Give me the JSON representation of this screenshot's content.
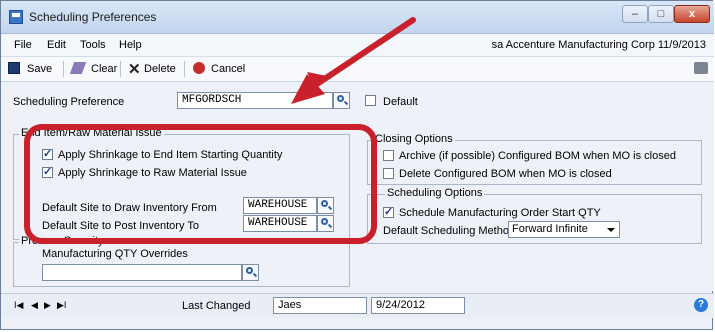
{
  "window": {
    "title": "Scheduling Preferences",
    "minimize": "–",
    "maximize": "□",
    "close": "x"
  },
  "menu": {
    "items": [
      "File",
      "Edit",
      "Tools",
      "Help"
    ],
    "company": "sa  Accenture Manufacturing Corp  11/9/2013"
  },
  "toolbar": {
    "save": "Save",
    "clear": "Clear",
    "delete": "Delete",
    "cancel": "Cancel"
  },
  "preference": {
    "label": "Scheduling Preference",
    "value": "MFGORDSCH",
    "default_label": "Default"
  },
  "end_item": {
    "title": "End Item/Raw Material Issue",
    "shrink_end": "Apply Shrinkage to End Item Starting Quantity",
    "shrink_raw": "Apply Shrinkage to Raw Material Issue",
    "draw_label": "Default Site to Draw Inventory From",
    "draw_value": "WAREHOUSE",
    "post_label": "Default Site to Post Inventory To",
    "post_value": "WAREHOUSE"
  },
  "closing": {
    "title": "Closing Options",
    "archive": "Archive (if possible) Configured BOM when MO is closed",
    "delete": "Delete Configured BOM when MO is closed"
  },
  "scheduling": {
    "title": "Scheduling Options",
    "start_qty": "Schedule Manufacturing Order Start QTY",
    "method_label": "Default Scheduling Method",
    "method_value": "Forward Infinite"
  },
  "process_security": {
    "title": "Process Security",
    "qty_label": "Manufacturing QTY Overrides",
    "qty_value": ""
  },
  "status": {
    "nav": [
      "I◀",
      "◀",
      "▶",
      "▶I"
    ],
    "changed_label": "Last Changed",
    "user": "Jaes",
    "date": "9/24/2012",
    "help": "?"
  },
  "colors": {
    "annotation_red": "#c9202b",
    "window_bg": "#eef2f8"
  }
}
